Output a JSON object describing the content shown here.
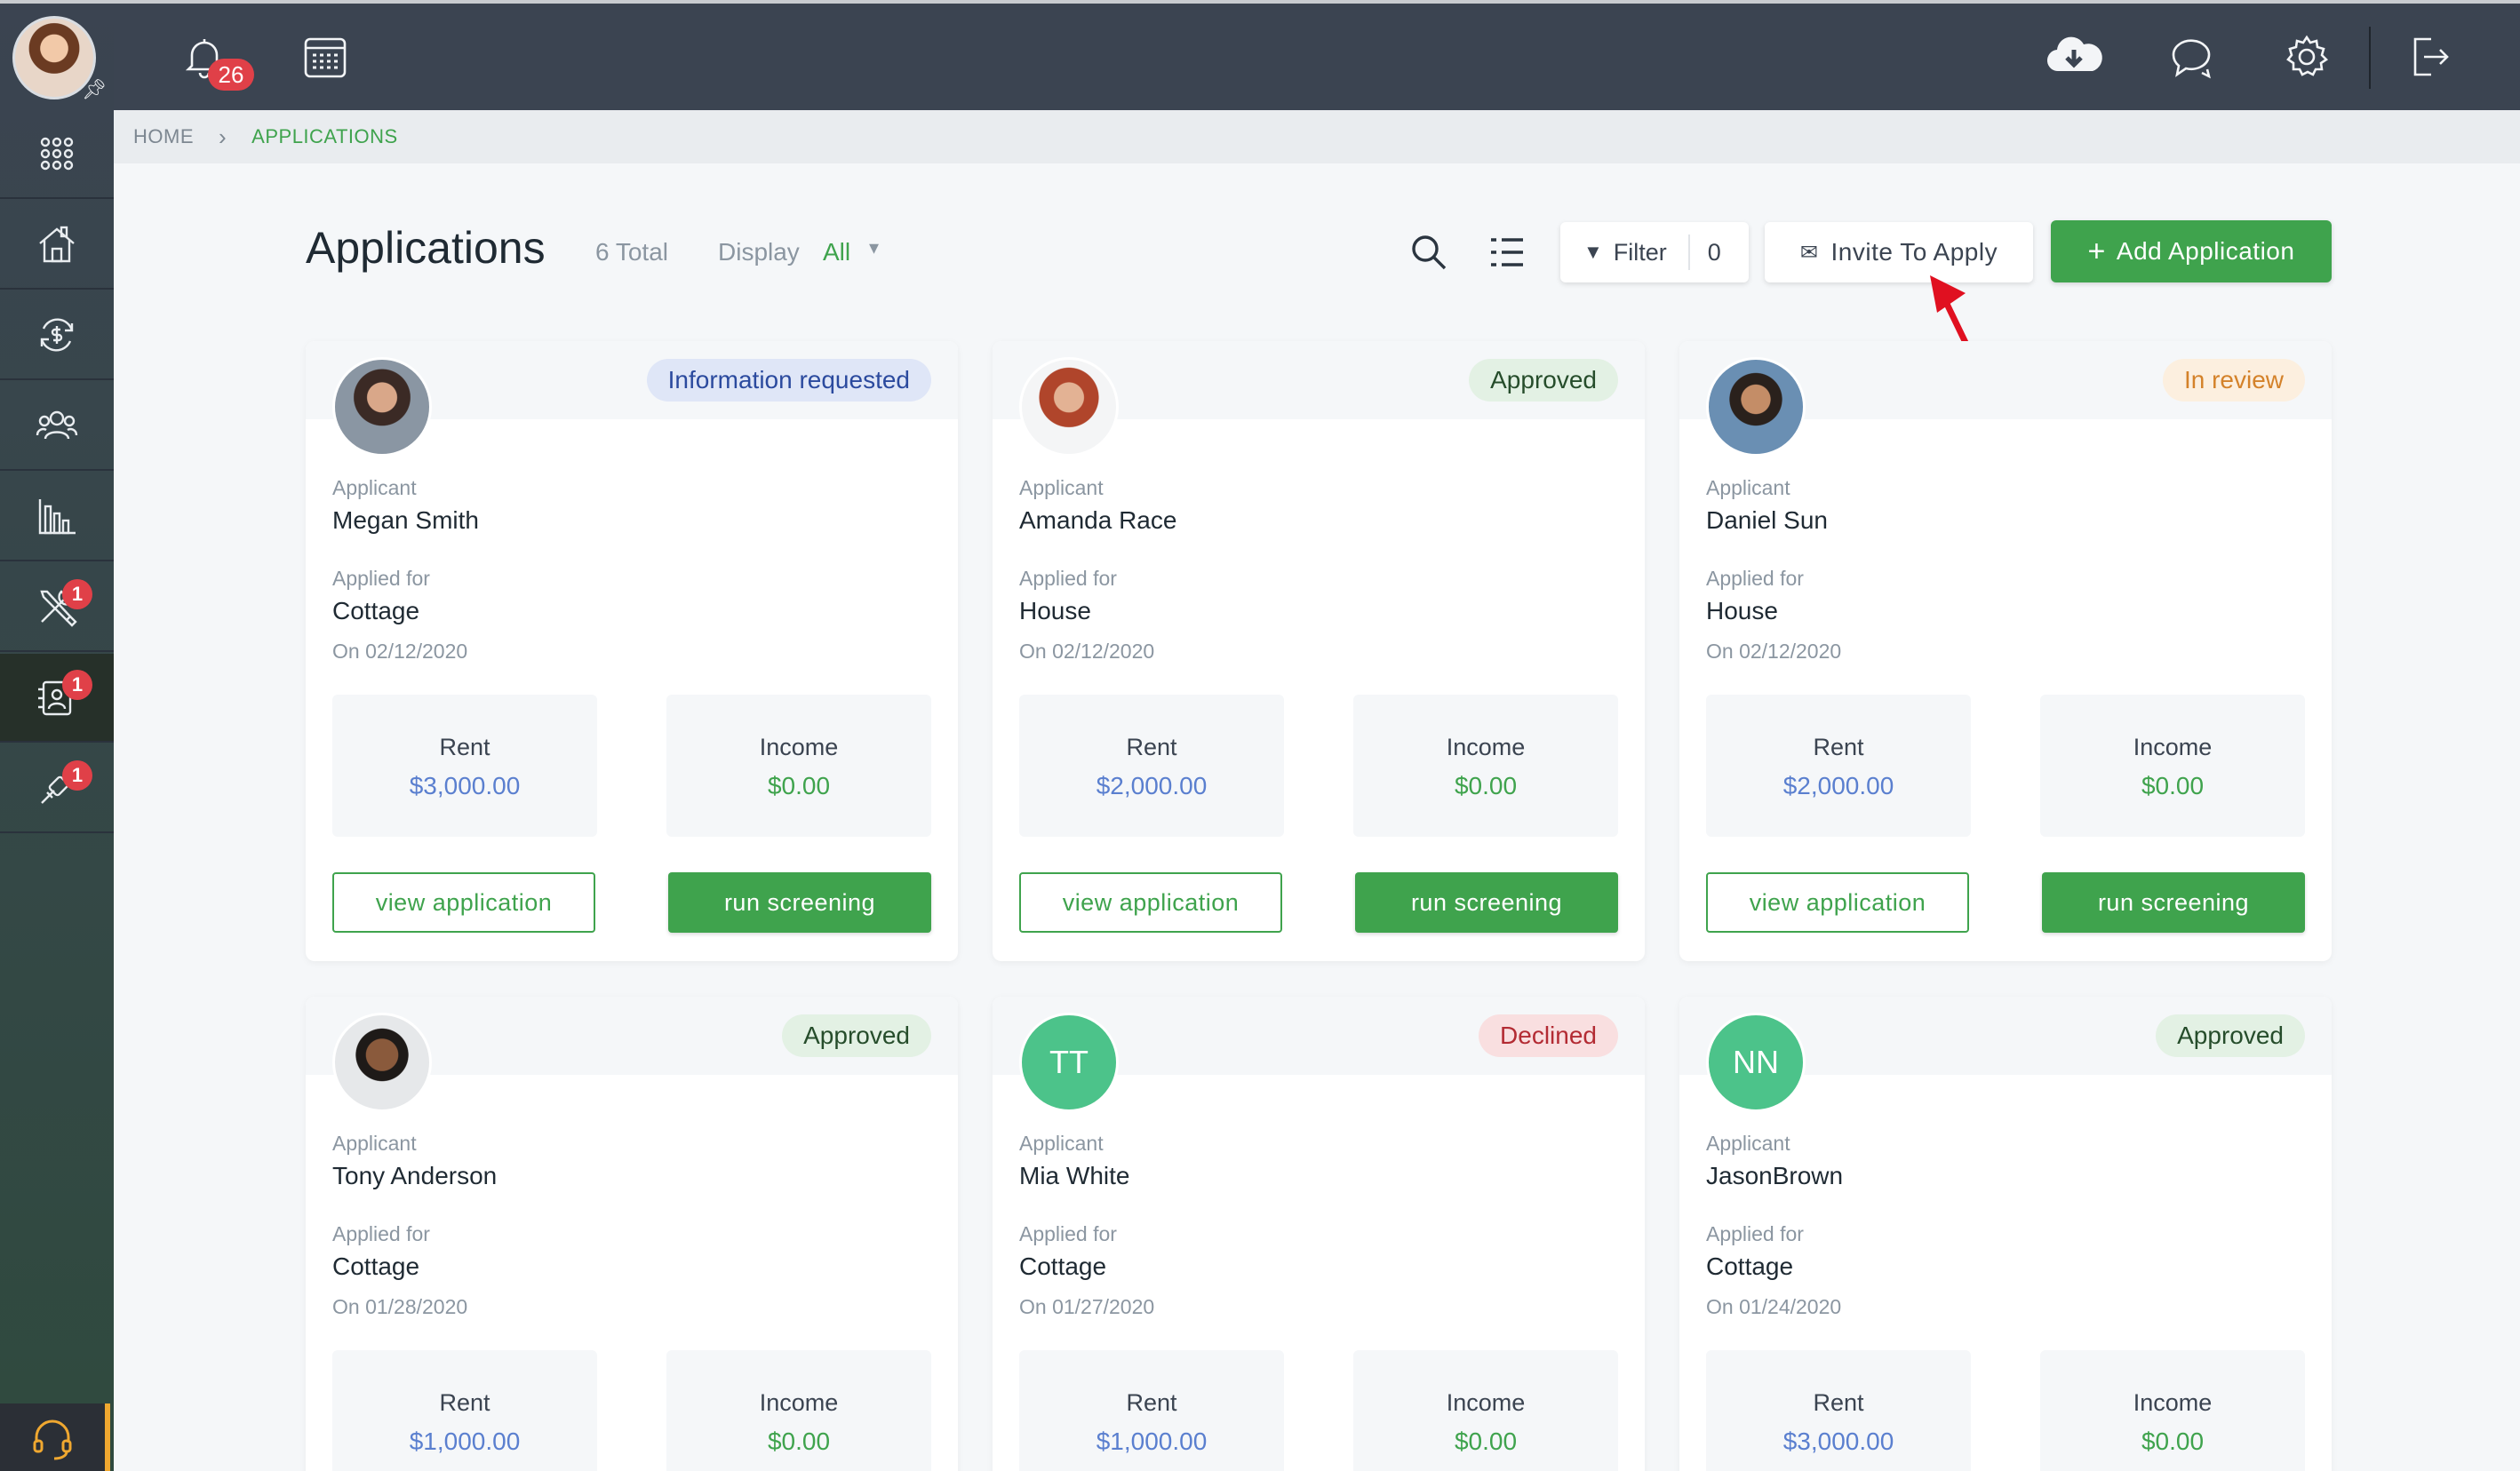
{
  "topbar": {
    "notification_count": "26",
    "icons": [
      "bell-icon",
      "calendar-icon",
      "cloud-download-icon",
      "chat-icon",
      "gear-icon",
      "logout-icon"
    ]
  },
  "sidebar": {
    "items": [
      {
        "icon": "apps-grid-icon",
        "badge": ""
      },
      {
        "icon": "properties-icon",
        "badge": ""
      },
      {
        "icon": "payments-icon",
        "badge": ""
      },
      {
        "icon": "people-icon",
        "badge": ""
      },
      {
        "icon": "reports-icon",
        "badge": ""
      },
      {
        "icon": "maintenance-icon",
        "badge": "1"
      },
      {
        "icon": "applications-icon",
        "badge": "1",
        "active": true
      },
      {
        "icon": "tools-icon",
        "badge": "1"
      }
    ],
    "support_icon": "headset-icon"
  },
  "breadcrumb": {
    "home": "HOME",
    "current": "APPLICATIONS"
  },
  "header": {
    "title": "Applications",
    "total": "6 Total",
    "display_label": "Display",
    "display_value": "All",
    "filter_label": "Filter",
    "filter_count": "0",
    "invite_label": "Invite To Apply",
    "add_label": "Add Application"
  },
  "labels": {
    "applicant": "Applicant",
    "applied_for": "Applied for",
    "rent": "Rent",
    "income": "Income",
    "view_button": "view application",
    "run_button": "run screening"
  },
  "colors": {
    "accent": "#3fa34d",
    "rent_value": "#5a7fcf",
    "badge": "#e04048"
  },
  "applications": [
    {
      "name": "Megan Smith",
      "initials": "",
      "status": "Information requested",
      "status_type": "info",
      "property": "Cottage",
      "date": "On 02/12/2020",
      "rent": "$3,000.00",
      "income": "$0.00"
    },
    {
      "name": "Amanda Race",
      "initials": "",
      "status": "Approved",
      "status_type": "approved",
      "property": "House",
      "date": "On 02/12/2020",
      "rent": "$2,000.00",
      "income": "$0.00"
    },
    {
      "name": "Daniel Sun",
      "initials": "",
      "status": "In review",
      "status_type": "review",
      "property": "House",
      "date": "On 02/12/2020",
      "rent": "$2,000.00",
      "income": "$0.00"
    },
    {
      "name": "Tony Anderson",
      "initials": "",
      "status": "Approved",
      "status_type": "approved",
      "property": "Cottage",
      "date": "On 01/28/2020",
      "rent": "$1,000.00",
      "income": "$0.00"
    },
    {
      "name": "Mia White",
      "initials": "TT",
      "status": "Declined",
      "status_type": "declined",
      "property": "Cottage",
      "date": "On 01/27/2020",
      "rent": "$1,000.00",
      "income": "$0.00"
    },
    {
      "name": "JasonBrown",
      "initials": "NN",
      "status": "Approved",
      "status_type": "approved",
      "property": "Cottage",
      "date": "On 01/24/2020",
      "rent": "$3,000.00",
      "income": "$0.00"
    }
  ]
}
